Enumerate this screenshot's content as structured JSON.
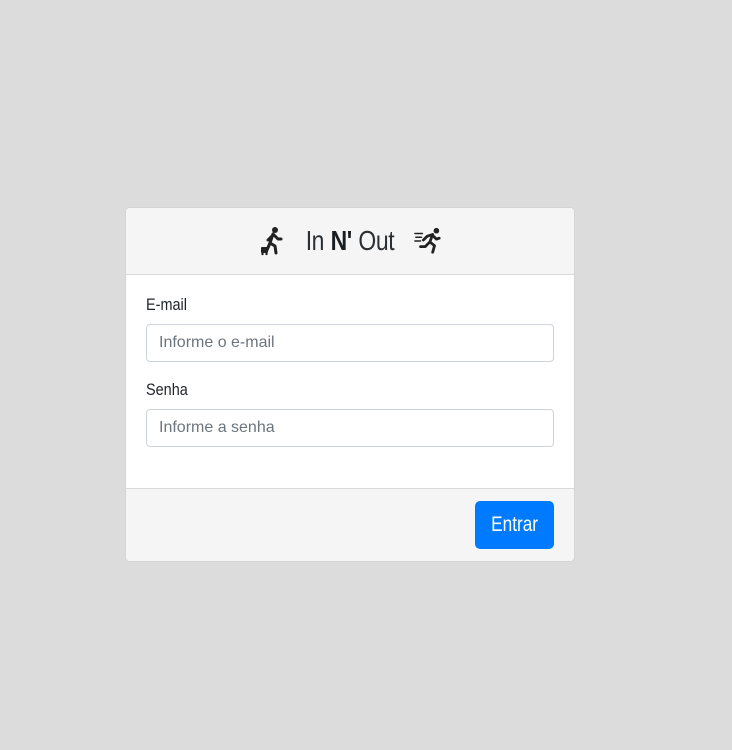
{
  "login_card": {
    "header": {
      "brand_prefix": "In",
      "brand_middle": "N'",
      "brand_suffix": "Out",
      "left_icon": "person-walking-luggage-icon",
      "right_icon": "person-running-icon"
    },
    "form": {
      "email_label": "E-mail",
      "email_placeholder": "Informe o e-mail",
      "email_value": "",
      "password_label": "Senha",
      "password_placeholder": "Informe a senha",
      "password_value": ""
    },
    "footer": {
      "submit_label": "Entrar"
    }
  },
  "colors": {
    "background": "#dcdcdc",
    "card_header_bg": "#f5f5f5",
    "primary_button": "#007bff"
  }
}
